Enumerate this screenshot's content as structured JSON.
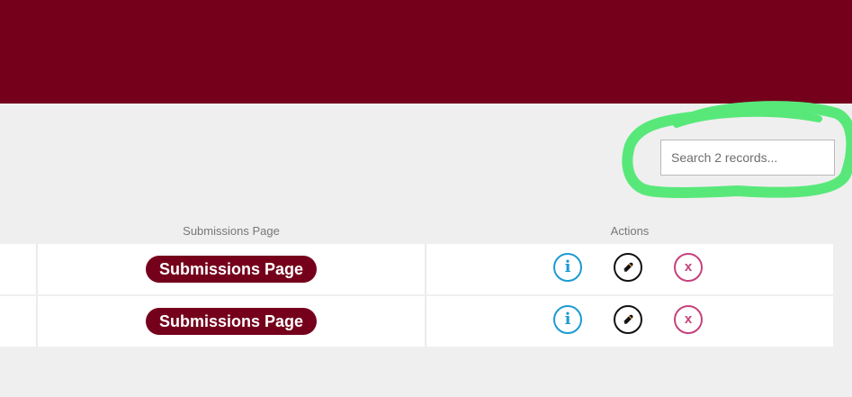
{
  "search": {
    "placeholder": "Search 2 records..."
  },
  "table": {
    "headers": {
      "submissions": "Submissions Page",
      "actions": "Actions"
    },
    "rows": [
      {
        "submissions_button": "Submissions Page",
        "info_glyph": "i",
        "delete_glyph": "x"
      },
      {
        "submissions_button": "Submissions Page",
        "info_glyph": "i",
        "delete_glyph": "x"
      }
    ]
  },
  "icons": {
    "info": "info-icon",
    "edit": "pencil-icon",
    "delete": "close-icon"
  },
  "colors": {
    "brand": "#75001b",
    "background": "#efefef",
    "highlight": "#58e87a",
    "info": "#1b9bd1",
    "delete": "#c6417b"
  }
}
